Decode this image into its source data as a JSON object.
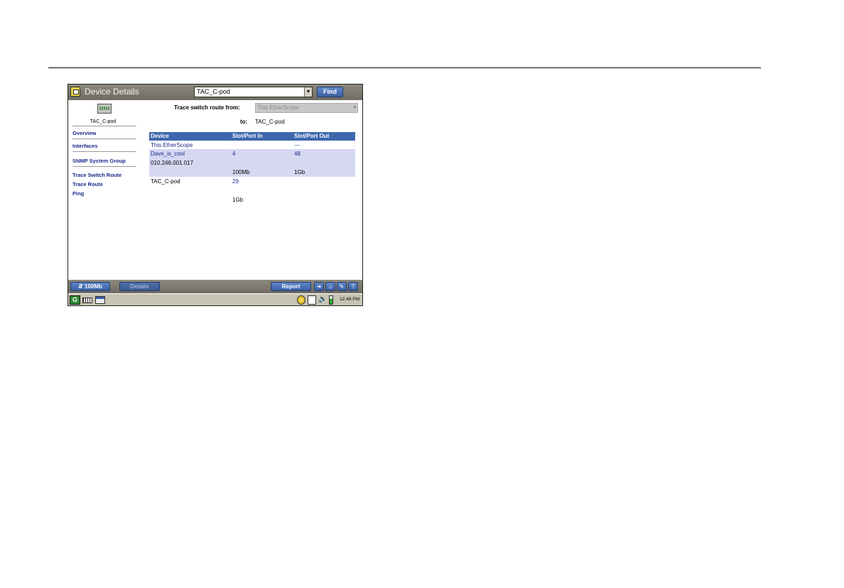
{
  "window": {
    "title": "Device Details",
    "device_select_value": "TAC_C-pod",
    "find_label": "Find"
  },
  "sidebar": {
    "device_name": "TAC_C-pod",
    "items": [
      {
        "label": "Overview"
      },
      {
        "label": "Interfaces"
      },
      {
        "label": "SNMP System Group"
      },
      {
        "label": "Trace Switch Route"
      },
      {
        "label": "Trace Route"
      },
      {
        "label": "Ping"
      }
    ]
  },
  "trace": {
    "from_label": "Trace switch route from:",
    "from_value": "This EtherScope",
    "to_label": "to:",
    "to_value": "TAC_C-pod"
  },
  "table": {
    "headers": [
      "Device",
      "Slot/Port In",
      "Slot/Port Out"
    ],
    "rows": [
      {
        "device": "This EtherScope",
        "device_sub": "",
        "port_in": "",
        "speed_in": "",
        "port_out": "---",
        "speed_out": ""
      },
      {
        "device": "Dave_is_cool",
        "device_sub": "010.246.001.017",
        "port_in": "4",
        "speed_in": "100Mb",
        "port_out": "48",
        "speed_out": "1Gb"
      },
      {
        "device": "TAC_C-pod",
        "device_sub": "",
        "port_in": "29",
        "speed_in": "1Gb",
        "port_out": "",
        "speed_out": ""
      }
    ]
  },
  "statusbar": {
    "speed_label": "100Mb",
    "details_label": "Details",
    "report_label": "Report",
    "icons": [
      "back-icon",
      "home-icon",
      "tools-icon",
      "help-icon"
    ]
  },
  "taskbar": {
    "clock": "12:48 PM",
    "icons": [
      "g-logo-icon",
      "keyboard-icon",
      "window-icon",
      "globe-icon",
      "clipboard-icon",
      "speaker-icon",
      "battery-icon"
    ]
  },
  "colors": {
    "header_blue": "#3f67ad",
    "row_highlight": "#d6d8f2",
    "link_blue": "#1a2a8c"
  }
}
